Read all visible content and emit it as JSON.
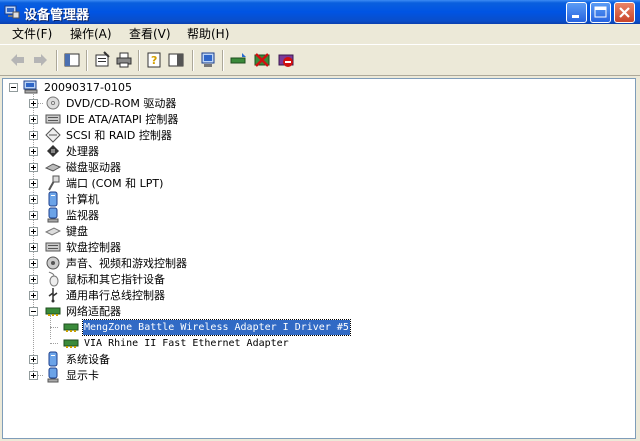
{
  "window": {
    "title": "设备管理器"
  },
  "menu": [
    {
      "label": "文件(F)"
    },
    {
      "label": "操作(A)"
    },
    {
      "label": "查看(V)"
    },
    {
      "label": "帮助(H)"
    }
  ],
  "toolbar": [
    "back-icon",
    "forward-icon",
    "show-hide-tree-icon",
    "properties-icon",
    "print-icon",
    "help-icon",
    "view-icon",
    "scan-hardware-icon",
    "update-driver-icon",
    "uninstall-icon",
    "disable-icon"
  ],
  "tree": {
    "root": "20090317-0105",
    "categories": [
      {
        "label": "DVD/CD-ROM 驱动器",
        "icon": "cdrom-icon"
      },
      {
        "label": "IDE ATA/ATAPI 控制器",
        "icon": "ide-controller-icon"
      },
      {
        "label": "SCSI 和 RAID 控制器",
        "icon": "scsi-icon"
      },
      {
        "label": "处理器",
        "icon": "processor-icon"
      },
      {
        "label": "磁盘驱动器",
        "icon": "disk-drive-icon"
      },
      {
        "label": "端口 (COM 和 LPT)",
        "icon": "port-icon"
      },
      {
        "label": "计算机",
        "icon": "computer-icon"
      },
      {
        "label": "监视器",
        "icon": "monitor-icon"
      },
      {
        "label": "键盘",
        "icon": "keyboard-icon"
      },
      {
        "label": "软盘控制器",
        "icon": "floppy-controller-icon"
      },
      {
        "label": "声音、视频和游戏控制器",
        "icon": "sound-icon"
      },
      {
        "label": "鼠标和其它指针设备",
        "icon": "mouse-icon"
      },
      {
        "label": "通用串行总线控制器",
        "icon": "usb-icon"
      },
      {
        "label": "网络适配器",
        "icon": "network-adapter-icon"
      },
      {
        "label": "系统设备",
        "icon": "system-device-icon"
      },
      {
        "label": "显示卡",
        "icon": "display-adapter-icon"
      }
    ],
    "network_children": [
      {
        "label": "MengZone Battle Wireless Adapter I Driver #5",
        "selected": true
      },
      {
        "label": "VIA Rhine II Fast Ethernet Adapter",
        "selected": false
      }
    ]
  },
  "colors": {
    "titlebar": "#0054e3",
    "selection": "#316ac5",
    "face": "#ece9d8"
  }
}
